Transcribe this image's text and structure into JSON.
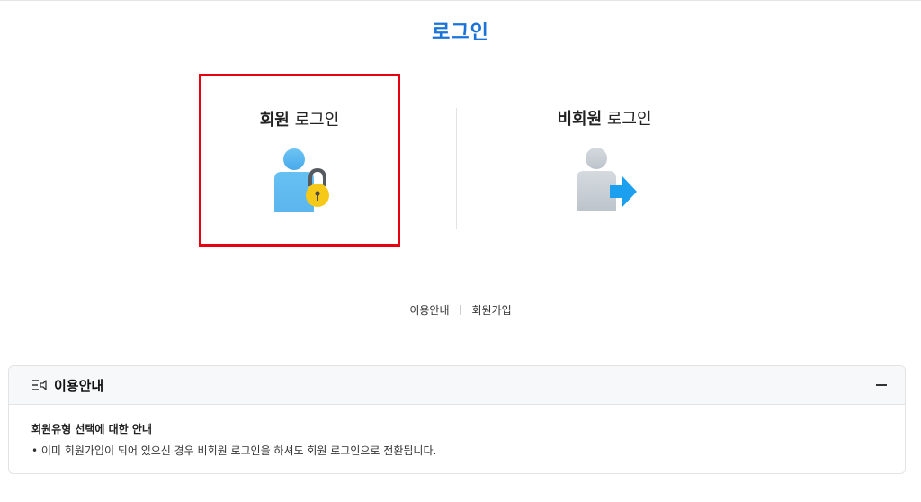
{
  "page": {
    "title": "로그인"
  },
  "options": {
    "member": {
      "title_bold": "회원",
      "title_rest": " 로그인"
    },
    "guest": {
      "title_bold": "비회원",
      "title_rest": " 로그인"
    }
  },
  "links": {
    "guide": "이용안내",
    "signup": "회원가입"
  },
  "guide_panel": {
    "title": "이용안내",
    "subtitle": "회원유형 선택에 대한 안내",
    "items": [
      "• 이미 회원가입이 되어 있으신 경우 비회원 로그인을 하셔도 회원 로그인으로 전환됩니다."
    ]
  },
  "icons": {
    "member": "user-lock-icon",
    "guest": "user-arrow-icon",
    "panel": "list-speaker-icon",
    "collapse": "minus-icon"
  },
  "colors": {
    "title": "#1a73d9",
    "highlight_border": "#e60012",
    "member_person": "#4fb3ef",
    "lock": "#f6c818",
    "guest_arrow": "#1aa0ee"
  }
}
